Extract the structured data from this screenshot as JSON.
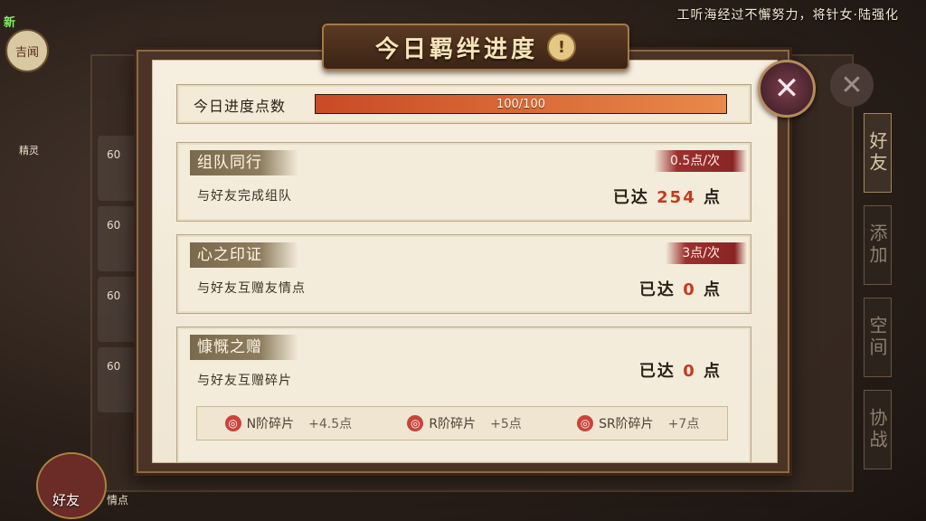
{
  "top_notice": "工听海经过不懈努力，将针女·陆强化",
  "left": {
    "new_badge": "新",
    "jiwen": "吉闻",
    "jingling": "精灵",
    "items": [
      "60",
      "60",
      "60",
      "60"
    ],
    "friend_label": "好友",
    "qingdian_label": "情点"
  },
  "right_tabs": [
    "好友",
    "添加",
    "空间",
    "协战"
  ],
  "modal": {
    "title": "今日羁绊进度",
    "info_icon": "!",
    "close_icon": "✕",
    "progress": {
      "label": "今日进度点数",
      "text": "100/100",
      "value": 1.0
    },
    "cards": [
      {
        "title": "组队同行",
        "desc": "与好友完成组队",
        "rate": "0.5点/次",
        "achieved_prefix": "已达",
        "achieved_value": "254",
        "achieved_suffix": "点"
      },
      {
        "title": "心之印证",
        "desc": "与好友互赠友情点",
        "rate": "3点/次",
        "achieved_prefix": "已达",
        "achieved_value": "0",
        "achieved_suffix": "点"
      },
      {
        "title": "慷慨之赠",
        "desc": "与好友互赠碎片",
        "achieved_prefix": "已达",
        "achieved_value": "0",
        "achieved_suffix": "点"
      }
    ],
    "shards": [
      {
        "label": "N阶碎片",
        "bonus": "+4.5点"
      },
      {
        "label": "R阶碎片",
        "bonus": "+5点"
      },
      {
        "label": "SR阶碎片",
        "bonus": "+7点"
      }
    ]
  },
  "colors": {
    "accent_red": "#c63a1c",
    "bar_fill": "#e9894a",
    "banner": "#5b3a23"
  }
}
